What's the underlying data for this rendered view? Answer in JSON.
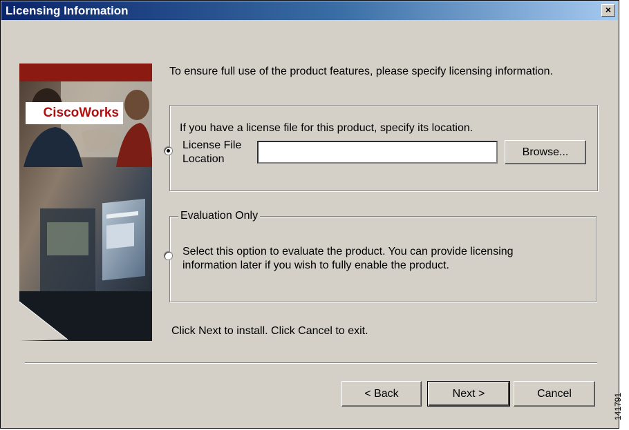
{
  "window": {
    "title": "Licensing Information",
    "close_label": "×"
  },
  "banner": {
    "logo_text": "CiscoWorks"
  },
  "intro_text": "To ensure full use of the product features, please specify licensing information.",
  "license_group": {
    "description": "If you have a license file for this product, specify its location.",
    "radio_selected": true,
    "label_line1": "License File",
    "label_line2": "Location",
    "file_input_value": "",
    "browse_label": "Browse..."
  },
  "evaluation_group": {
    "legend": "Evaluation Only",
    "radio_selected": false,
    "description_line1": "Select this option to evaluate the product. You can provide licensing",
    "description_line2": "information later if you wish to fully enable the product."
  },
  "footer_text": "Click Next to install. Click Cancel to exit.",
  "buttons": {
    "back": "< Back",
    "next": "Next >",
    "cancel": "Cancel"
  },
  "side_code": "141791"
}
